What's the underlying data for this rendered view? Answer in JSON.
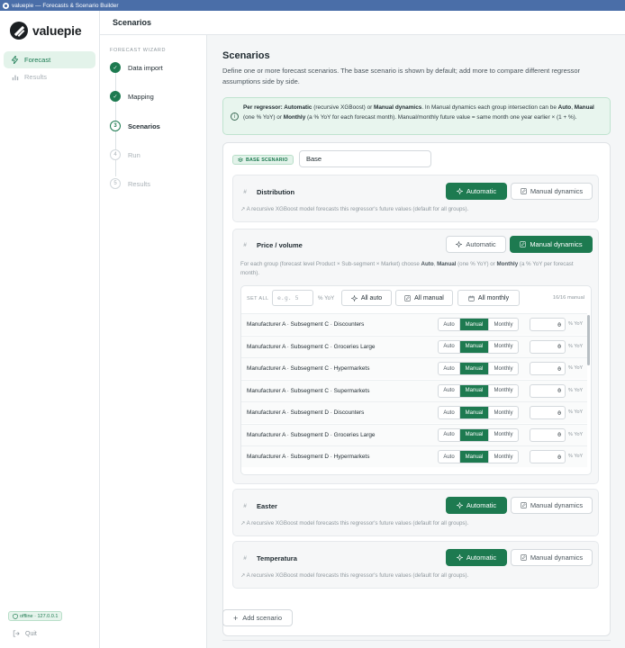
{
  "window": {
    "title": "valuepie — Forecasts & Scenario Builder"
  },
  "sidebar": {
    "logo_text": "valuepie",
    "items": [
      {
        "label": "Forecast",
        "icon": "bolt-icon",
        "active": true
      },
      {
        "label": "Results",
        "icon": "bar-chart-icon",
        "active": false
      }
    ],
    "status_badge": "offline · 127.0.0.1",
    "quit_label": "Quit"
  },
  "topbar": {
    "title": "Scenarios"
  },
  "wizard": {
    "heading": "FORECAST WIZARD",
    "steps": [
      {
        "label": "Data import",
        "state": "done",
        "marker": "✓"
      },
      {
        "label": "Mapping",
        "state": "done",
        "marker": "✓"
      },
      {
        "label": "Scenarios",
        "state": "current",
        "marker": "3"
      },
      {
        "label": "Run",
        "state": "pending",
        "marker": "4"
      },
      {
        "label": "Results",
        "state": "pending",
        "marker": "5"
      }
    ]
  },
  "main": {
    "title": "Scenarios",
    "description": "Define one or more forecast scenarios. The base scenario is shown by default; add more to compare different regressor assumptions side by side.",
    "info": {
      "p1": "Per regressor: ",
      "b1": "Automatic",
      "p2": " (recursive XGBoost) or ",
      "b2": "Manual dynamics",
      "p3": ". In Manual dynamics each group intersection can be ",
      "b3": "Auto",
      "p4": ", ",
      "b4": "Manual",
      "p5": " (one % YoY) or ",
      "b5": "Monthly",
      "p6": " (a % YoY for each forecast month). Manual/monthly future value = same month one year earlier × (1 + %)."
    },
    "scenario": {
      "badge": "BASE SCENARIO",
      "name_value": "Base",
      "automatic_label": "Automatic",
      "manual_label": "Manual dynamics",
      "auto_note": "A recursive XGBoost model forecasts this regressor's future values (default for all groups).",
      "regressors": [
        {
          "name": "Distribution",
          "mode": "automatic"
        },
        {
          "name": "Price / volume",
          "mode": "manual"
        },
        {
          "name": "Easter",
          "mode": "automatic"
        },
        {
          "name": "Temperatura",
          "mode": "automatic"
        }
      ],
      "manual_panel": {
        "note_p1": "For each group (forecast level Product × Sub-segment × Market) choose ",
        "note_b1": "Auto",
        "note_p2": ", ",
        "note_b2": "Manual",
        "note_p3": " (one % YoY) or ",
        "note_b3": "Monthly",
        "note_p4": " (a % YoY per forecast month).",
        "set_all_label": "SET ALL",
        "set_all_placeholder": "e.g. 5",
        "unit": "% YoY",
        "all_auto": "All auto",
        "all_manual": "All manual",
        "all_monthly": "All monthly",
        "count": "16/16 manual",
        "seg_auto": "Auto",
        "seg_manual": "Manual",
        "seg_monthly": "Monthly",
        "unit_small": "% YoY",
        "groups": [
          {
            "name": "Manufacturer A · Subsegment C · Discounters",
            "value": "0"
          },
          {
            "name": "Manufacturer A · Subsegment C · Groceries Large",
            "value": "0"
          },
          {
            "name": "Manufacturer A · Subsegment C · Hypermarkets",
            "value": "0"
          },
          {
            "name": "Manufacturer A · Subsegment C · Supermarkets",
            "value": "0"
          },
          {
            "name": "Manufacturer A · Subsegment D · Discounters",
            "value": "0"
          },
          {
            "name": "Manufacturer A · Subsegment D · Groceries Large",
            "value": "0"
          },
          {
            "name": "Manufacturer A · Subsegment D · Hypermarkets",
            "value": "0"
          }
        ]
      }
    },
    "add_scenario_label": "Add scenario"
  },
  "colors": {
    "accent": "#1d7a50",
    "accent_light": "#e3f3ea",
    "info_bg": "#e8f5ee",
    "titlebar": "#4a6ea8"
  }
}
